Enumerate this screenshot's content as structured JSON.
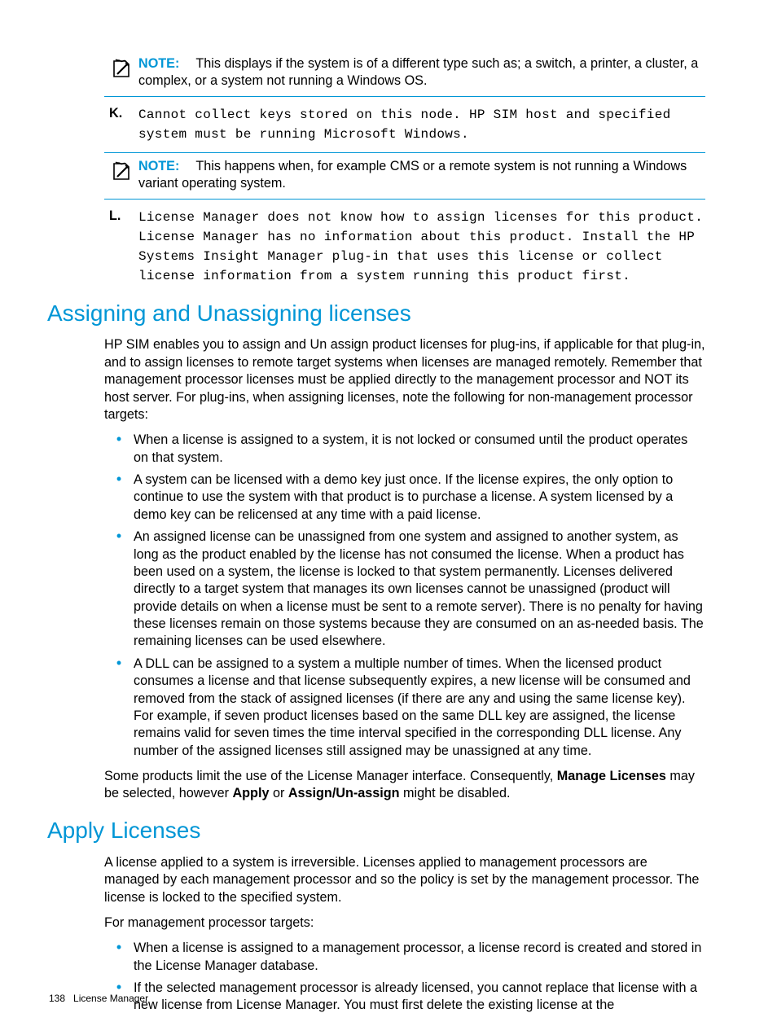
{
  "notes": {
    "note1": {
      "label": "NOTE:",
      "text": "This displays if the system is of a different type such as; a switch, a printer, a cluster, a complex, or a system not running a Windows OS."
    },
    "note2": {
      "label": "NOTE:",
      "text": "This happens when, for example CMS or a remote system is not running a Windows variant operating system."
    }
  },
  "items": {
    "K": {
      "marker": "K.",
      "text": "Cannot collect keys stored on this node. HP SIM host and specified system must be running Microsoft Windows."
    },
    "L": {
      "marker": "L.",
      "text": "License Manager does not know how to assign licenses for this product. License Manager has no information about this product. Install the HP Systems Insight Manager plug-in that uses this license or collect license information from a system running this product first."
    }
  },
  "section1": {
    "heading": "Assigning and Unassigning licenses",
    "intro": "HP SIM enables you to assign and Un assign product licenses for plug-ins, if applicable for that plug-in, and to assign licenses to remote target systems when licenses are managed remotely. Remember that management processor licenses must be applied directly to the management processor and NOT its host server. For plug-ins, when assigning licenses, note the following for non-management processor targets:",
    "bullets": [
      "When a license is assigned to a system, it is not locked or consumed until the product operates on that system.",
      "A system can be licensed with a demo key just once. If the license expires, the only option to continue to use the system with that product is to purchase a license. A system licensed by a demo key can be relicensed at any time with a paid license.",
      "An assigned license can be unassigned from one system and assigned to another system, as long as the product enabled by the license has not consumed the license. When a product has been used on a system, the license is locked to that system permanently. Licenses delivered directly to a target system that manages its own licenses cannot be unassigned (product will provide details on when a license must be sent to a remote server). There is no penalty for having these licenses remain on those systems because they are consumed on an as-needed basis. The remaining licenses can be used elsewhere.",
      "A DLL can be assigned to a system a multiple number of times. When the licensed product consumes a license and that license subsequently expires, a new license will be consumed and removed from the stack of assigned licenses (if there are any and using the same license key). For example, if seven product licenses based on the same DLL key are assigned, the license remains valid for seven times the time interval specified in the corresponding DLL license. Any number of the assigned licenses still assigned may be unassigned at any time."
    ],
    "closing_pre": "Some products limit the use of the License Manager interface. Consequently, ",
    "closing_b1": "Manage Licenses",
    "closing_mid1": " may be selected, however ",
    "closing_b2": "Apply",
    "closing_mid2": " or ",
    "closing_b3": "Assign/Un-assign",
    "closing_post": " might be disabled."
  },
  "section2": {
    "heading": "Apply Licenses",
    "intro": "A license applied to a system is irreversible. Licenses applied to management processors are managed by each management processor and so the policy is set by the management processor. The license is locked to the specified system.",
    "lead": "For management processor targets:",
    "bullets": [
      "When a license is assigned to a management processor, a license record is created and stored in the License Manager database.",
      "If the selected management processor is already licensed, you cannot replace that license with a new license from License Manager. You must first delete the existing license at the"
    ]
  },
  "footer": {
    "page": "138",
    "title": "License Manager"
  }
}
